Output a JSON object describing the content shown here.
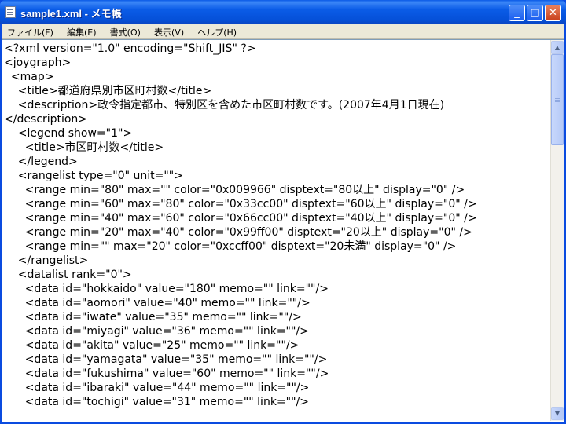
{
  "window": {
    "title": "sample1.xml - メモ帳",
    "minimize_symbol": "_",
    "maximize_symbol": "□",
    "close_symbol": "✕"
  },
  "menu": [
    "ファイル(F)",
    "編集(E)",
    "書式(O)",
    "表示(V)",
    "ヘルプ(H)"
  ],
  "editor": {
    "lines": [
      "<?xml version=\"1.0\" encoding=\"Shift_JIS\" ?>",
      "<joygraph>",
      "  <map>",
      "    <title>都道府県別市区町村数</title>",
      "    <description>政令指定都市、特別区を含めた市区町村数です。(2007年4月1日現在)",
      "</description>",
      "    <legend show=\"1\">",
      "      <title>市区町村数</title>",
      "    </legend>",
      "    <rangelist type=\"0\" unit=\"\">",
      "      <range min=\"80\" max=\"\" color=\"0x009966\" disptext=\"80以上\" display=\"0\" />",
      "      <range min=\"60\" max=\"80\" color=\"0x33cc00\" disptext=\"60以上\" display=\"0\" />",
      "      <range min=\"40\" max=\"60\" color=\"0x66cc00\" disptext=\"40以上\" display=\"0\" />",
      "      <range min=\"20\" max=\"40\" color=\"0x99ff00\" disptext=\"20以上\" display=\"0\" />",
      "      <range min=\"\" max=\"20\" color=\"0xccff00\" disptext=\"20未満\" display=\"0\" />",
      "    </rangelist>",
      "    <datalist rank=\"0\">",
      "      <data id=\"hokkaido\" value=\"180\" memo=\"\" link=\"\"/>",
      "      <data id=\"aomori\" value=\"40\" memo=\"\" link=\"\"/>",
      "      <data id=\"iwate\" value=\"35\" memo=\"\" link=\"\"/>",
      "      <data id=\"miyagi\" value=\"36\" memo=\"\" link=\"\"/>",
      "      <data id=\"akita\" value=\"25\" memo=\"\" link=\"\"/>",
      "      <data id=\"yamagata\" value=\"35\" memo=\"\" link=\"\"/>",
      "      <data id=\"fukushima\" value=\"60\" memo=\"\" link=\"\"/>",
      "      <data id=\"ibaraki\" value=\"44\" memo=\"\" link=\"\"/>",
      "      <data id=\"tochigi\" value=\"31\" memo=\"\" link=\"\"/>"
    ]
  },
  "scrollbar": {
    "up_symbol": "▲",
    "down_symbol": "▼"
  }
}
